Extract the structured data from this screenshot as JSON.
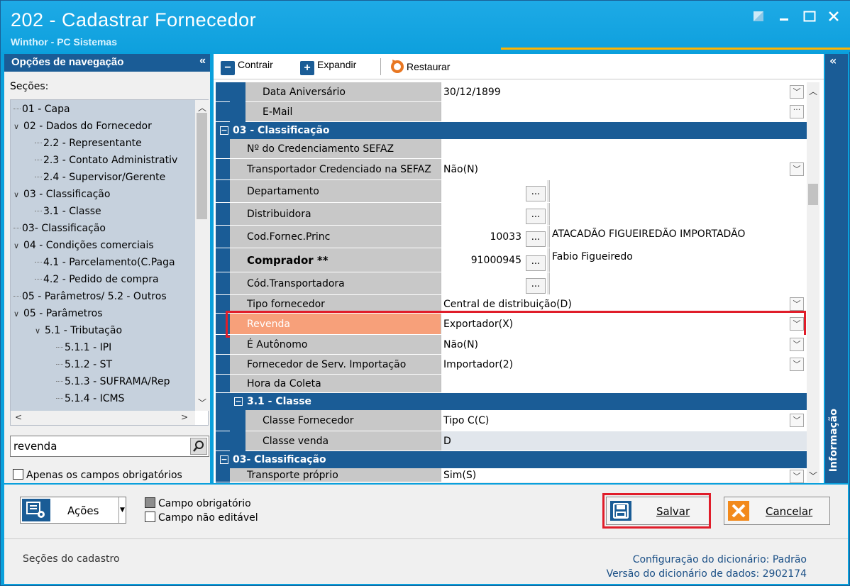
{
  "window": {
    "title": "202 - Cadastrar  Fornecedor",
    "subtitle": "Winthor - PC Sistemas",
    "controls": [
      "restore-icon",
      "minimize-icon",
      "maximize-icon",
      "close-icon"
    ]
  },
  "nav": {
    "header": "Opções de navegação",
    "collapse": "«",
    "sections_label": "Seções:",
    "tree": [
      {
        "label": "01 - Capa",
        "level": 0,
        "toggle": ""
      },
      {
        "label": "02 - Dados do Fornecedor",
        "level": 0,
        "toggle": "v"
      },
      {
        "label": "2.2 - Representante",
        "level": 1,
        "toggle": ""
      },
      {
        "label": "2.3 - Contato Administrativ",
        "level": 1,
        "toggle": ""
      },
      {
        "label": "2.4 - Supervisor/Gerente",
        "level": 1,
        "toggle": ""
      },
      {
        "label": "03 - Classificação",
        "level": 0,
        "toggle": "v"
      },
      {
        "label": "3.1 - Classe",
        "level": 1,
        "toggle": ""
      },
      {
        "label": "03- Classificação",
        "level": 0,
        "toggle": ""
      },
      {
        "label": "04 - Condições comerciais",
        "level": 0,
        "toggle": "v"
      },
      {
        "label": "4.1 - Parcelamento(C.Paga",
        "level": 1,
        "toggle": ""
      },
      {
        "label": "4.2 - Pedido de compra",
        "level": 1,
        "toggle": ""
      },
      {
        "label": "05 - Parâmetros/ 5.2 - Outros",
        "level": 0,
        "toggle": ""
      },
      {
        "label": "05 - Parâmetros",
        "level": 0,
        "toggle": "v"
      },
      {
        "label": "5.1 - Tributação",
        "level": 1,
        "toggle": "v"
      },
      {
        "label": "5.1.1 - IPI",
        "level": 2,
        "toggle": ""
      },
      {
        "label": "5.1.2 - ST",
        "level": 2,
        "toggle": ""
      },
      {
        "label": "5.1.3 - SUFRAMA/Rep",
        "level": 2,
        "toggle": ""
      },
      {
        "label": "5.1.4 - ICMS",
        "level": 2,
        "toggle": ""
      }
    ],
    "search_value": "revenda",
    "required_only_label": "Apenas os campos obrigatórios"
  },
  "toolbar": {
    "collapse": "Contrair",
    "expand": "Expandir",
    "restore": "Restaurar",
    "panel_collapse": "«"
  },
  "grid": {
    "rows": [
      {
        "kind": "field",
        "label": "Data Aniversário",
        "value": "30/12/1899",
        "control": "dropdown",
        "indent": 2
      },
      {
        "kind": "field",
        "label": "E-Mail",
        "value": "",
        "control": "ellipsis-small",
        "indent": 2
      },
      {
        "kind": "section",
        "label": "03 - Classificação",
        "indent": 0
      },
      {
        "kind": "field",
        "label": "Nº do Credenciamento SEFAZ",
        "value": "",
        "control": "none",
        "indent": 1
      },
      {
        "kind": "field",
        "label": "Transportador Credenciado na SEFAZ",
        "value": "Não(N)",
        "control": "dropdown",
        "indent": 1
      },
      {
        "kind": "lookup",
        "label": "Departamento",
        "code": "",
        "desc": "",
        "indent": 1
      },
      {
        "kind": "lookup",
        "label": "Distribuidora",
        "code": "",
        "desc": "",
        "indent": 1
      },
      {
        "kind": "lookup",
        "label": "Cod.Fornec.Princ",
        "code": "10033",
        "desc": "ATACADÃO FIGUEIREDÃO IMPORTADÃO",
        "indent": 1
      },
      {
        "kind": "lookup",
        "label": "Comprador **",
        "code": "91000945",
        "desc": "Fabio Figueiredo",
        "indent": 1,
        "bold": true
      },
      {
        "kind": "lookup",
        "label": "Cód.Transportadora",
        "code": "",
        "desc": "",
        "indent": 1
      },
      {
        "kind": "field",
        "label": "Tipo fornecedor",
        "value": "Central de distribuição(D)",
        "control": "dropdown",
        "indent": 1
      },
      {
        "kind": "field",
        "label": "Revenda",
        "value": "Exportador(X)",
        "control": "dropdown",
        "indent": 1,
        "highlight": true
      },
      {
        "kind": "field",
        "label": "É Autônomo",
        "value": "Não(N)",
        "control": "dropdown",
        "indent": 1
      },
      {
        "kind": "field",
        "label": "Fornecedor de Serv. Importação",
        "value": "Importador(2)",
        "control": "dropdown",
        "indent": 1
      },
      {
        "kind": "field",
        "label": "Hora da Coleta",
        "value": "",
        "control": "none",
        "indent": 1
      },
      {
        "kind": "section",
        "label": "3.1 - Classe",
        "indent": 1
      },
      {
        "kind": "field",
        "label": "Classe Fornecedor",
        "value": "Tipo C(C)",
        "control": "dropdown",
        "indent": 2
      },
      {
        "kind": "field",
        "label": "Classe venda",
        "value": "D",
        "control": "readonly",
        "indent": 2
      },
      {
        "kind": "section",
        "label": "03- Classificação",
        "indent": 0
      },
      {
        "kind": "field",
        "label": "Transporte próprio",
        "value": "Sim(S)",
        "control": "dropdown",
        "indent": 1
      }
    ]
  },
  "info_panel": {
    "label": "Informação",
    "collapse": "«"
  },
  "footer": {
    "actions_label": "Ações",
    "legend_required": "Campo obrigatório",
    "legend_readonly": "Campo não editável",
    "save": "Salvar",
    "cancel": "Cancelar",
    "status_left": "Seções do cadastro",
    "dict_config_label": "Configuração do dicionário:",
    "dict_config_value": "Padrão",
    "dict_version_label": "Versão do dicionário de dados:",
    "dict_version_value": "2902174"
  },
  "colors": {
    "title_bg": "#0ea0dd",
    "section_bg": "#1a5c96",
    "label_bg": "#c8c8c8",
    "highlight_label": "#f7a07a",
    "highlight_border": "#e01d2a",
    "accent_line": "#ffb400"
  }
}
